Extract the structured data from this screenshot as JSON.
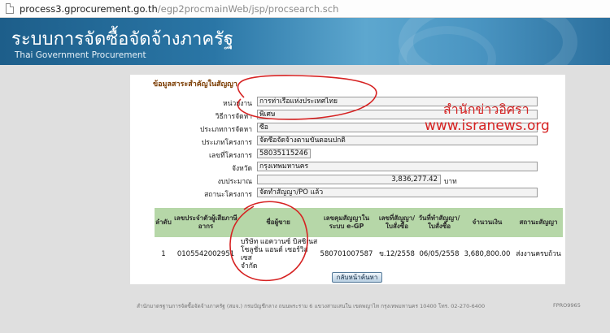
{
  "address_bar": {
    "host": "process3.gprocurement.go.th",
    "path": "/egp2procmainWeb/jsp/procsearch.sch"
  },
  "header": {
    "title_th": "ระบบการจัดซื้อจัดจ้างภาครัฐ",
    "title_en": "Thai Government Procurement"
  },
  "contract": {
    "section_title": "ข้อมูลสาระสำคัญในสัญญา",
    "fields": [
      {
        "label": "หน่วยงาน",
        "value": "การท่าเรือแห่งประเทศไทย"
      },
      {
        "label": "วิธีการจัดหา",
        "value": "พิเศษ"
      },
      {
        "label": "ประเภทการจัดหา",
        "value": "ซื้อ"
      },
      {
        "label": "ประเภทโครงการ",
        "value": "จัดซื้อจัดจ้างตามขั้นตอนปกติ"
      },
      {
        "label": "เลขที่โครงการ",
        "value": "58035115246"
      },
      {
        "label": "จังหวัด",
        "value": "กรุงเทพมหานคร"
      },
      {
        "label": "งบประมาณ",
        "value": "3,836,277.42",
        "unit": "บาท"
      },
      {
        "label": "สถานะโครงการ",
        "value": "จัดทำสัญญา/PO แล้ว"
      }
    ]
  },
  "table": {
    "headers": [
      "ลำดับ",
      "เลขประจำตัวผู้เสียภาษีอากร",
      "ชื่อผู้ขาย",
      "เลขคุมสัญญาในระบบ e-GP",
      "เลขที่สัญญา/ใบสั่งซื้อ",
      "วันที่ทำสัญญา/ใบสั่งซื้อ",
      "จำนวนเงิน",
      "สถานะสัญญา"
    ],
    "rows": [
      {
        "no": "1",
        "tax_id": "0105542002951",
        "vendor_line1": "บริษัท แอควานซ์ บิสซิเนส",
        "vendor_line2": "โซลูชั่น แอนด์ เซอร์วิสเซส",
        "vendor_line3": "จำกัด",
        "egp_no": "580701007587",
        "contract_no": "ข.12/2558",
        "date": "06/05/2558",
        "amount": "3,680,800.00",
        "status": "ส่งงานครบถ้วน"
      }
    ]
  },
  "back_button": "กลับหน้าค้นหา",
  "footer": {
    "text": "สำนักมาตรฐานการจัดซื้อจัดจ้างภาครัฐ (สมจ.) กรมบัญชีกลาง ถนนพระราม 6 แขวงสามเสนใน เขตพญาไท กรุงเทพมหานคร 10400 โทร. 02-270-6400",
    "code": "FPRO9965"
  },
  "watermark": {
    "line1": "สำนักข่าวอิศรา",
    "line2": "www.isranews.org"
  },
  "colors": {
    "banner": "#2a76a6",
    "table_header": "#b6d7a8",
    "section_title": "#7a3b00",
    "annotation": "#d62222"
  }
}
